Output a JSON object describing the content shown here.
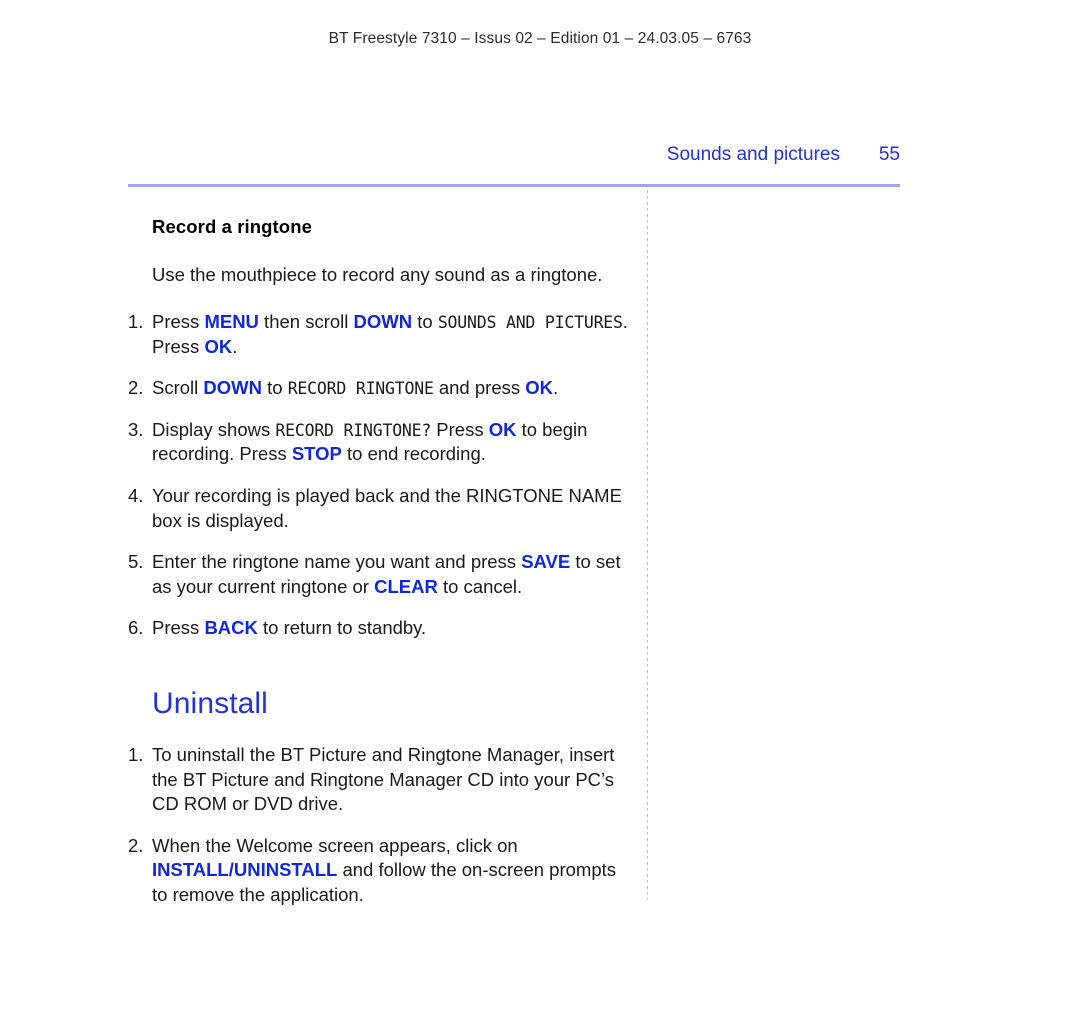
{
  "document": {
    "running_header": "BT Freestyle 7310 – Issus 02 – Edition 01 – 24.03.05 – 6763",
    "section_title": "Sounds and pictures",
    "page_number": "55"
  },
  "colors": {
    "accent_blue": "#2233dd",
    "key_blue": "#0f27e0",
    "rule_lavender": "#a3a3f5"
  },
  "record_ringtone": {
    "heading": "Record a ringtone",
    "intro": "Use the mouthpiece to record any sound as a ringtone.",
    "steps": [
      {
        "num": "1.",
        "parts": [
          {
            "text": "Press ",
            "style": "plain"
          },
          {
            "text": "MENU",
            "style": "key"
          },
          {
            "text": " then scroll ",
            "style": "plain"
          },
          {
            "text": "DOWN",
            "style": "key"
          },
          {
            "text": " to ",
            "style": "plain"
          },
          {
            "text": "SOUNDS AND PICTURES",
            "style": "lcd"
          },
          {
            "text": ". Press ",
            "style": "plain"
          },
          {
            "text": "OK",
            "style": "key"
          },
          {
            "text": ".",
            "style": "plain"
          }
        ]
      },
      {
        "num": "2.",
        "parts": [
          {
            "text": "Scroll ",
            "style": "plain"
          },
          {
            "text": "DOWN",
            "style": "key"
          },
          {
            "text": " to ",
            "style": "plain"
          },
          {
            "text": "RECORD RINGTONE",
            "style": "lcd"
          },
          {
            "text": " and press ",
            "style": "plain"
          },
          {
            "text": "OK",
            "style": "key"
          },
          {
            "text": ".",
            "style": "plain"
          }
        ]
      },
      {
        "num": "3.",
        "parts": [
          {
            "text": "Display shows ",
            "style": "plain"
          },
          {
            "text": "RECORD RINGTONE?",
            "style": "lcd"
          },
          {
            "text": " Press ",
            "style": "plain"
          },
          {
            "text": "OK",
            "style": "key"
          },
          {
            "text": " to begin recording. Press ",
            "style": "plain"
          },
          {
            "text": "STOP",
            "style": "key"
          },
          {
            "text": " to end recording.",
            "style": "plain"
          }
        ]
      },
      {
        "num": "4.",
        "parts": [
          {
            "text": "Your recording is played back and the ",
            "style": "plain"
          },
          {
            "text": "RINGTONE NAME",
            "style": "caps"
          },
          {
            "text": " box is displayed.",
            "style": "plain"
          }
        ]
      },
      {
        "num": "5.",
        "parts": [
          {
            "text": "Enter the ringtone name you want and press ",
            "style": "plain"
          },
          {
            "text": "SAVE",
            "style": "key"
          },
          {
            "text": " to set as your current ringtone or ",
            "style": "plain"
          },
          {
            "text": "CLEAR",
            "style": "key"
          },
          {
            "text": " to cancel.",
            "style": "plain"
          }
        ]
      },
      {
        "num": "6.",
        "parts": [
          {
            "text": "Press ",
            "style": "plain"
          },
          {
            "text": "BACK",
            "style": "key"
          },
          {
            "text": " to return to standby.",
            "style": "plain"
          }
        ]
      }
    ]
  },
  "uninstall": {
    "heading": "Uninstall",
    "steps": [
      {
        "num": "1.",
        "parts": [
          {
            "text": "To uninstall the BT Picture and Ringtone Manager, insert the BT Picture and Ringtone Manager CD into your PC’s CD ROM or DVD drive.",
            "style": "plain"
          }
        ]
      },
      {
        "num": "2.",
        "parts": [
          {
            "text": "When the Welcome screen appears, click on ",
            "style": "plain"
          },
          {
            "text": "INSTALL/UNINSTALL",
            "style": "key"
          },
          {
            "text": " and follow the on-screen prompts to remove the application.",
            "style": "plain"
          }
        ]
      }
    ]
  }
}
